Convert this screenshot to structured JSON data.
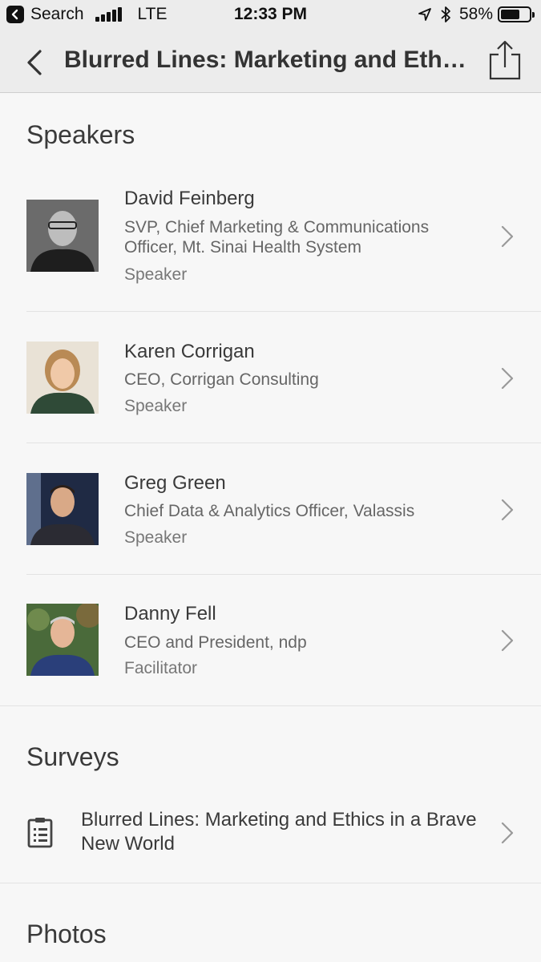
{
  "status_bar": {
    "back_app": "Search",
    "carrier": "LTE",
    "time": "12:33 PM",
    "battery": "58%",
    "battery_level": 0.58
  },
  "nav": {
    "title": "Blurred Lines: Marketing and Ethi...",
    "back_icon": "chevron-left-icon",
    "share_icon": "share-icon"
  },
  "speakers": {
    "header": "Speakers",
    "items": [
      {
        "name": "David Feinberg",
        "title": "SVP, Chief Marketing & Communications Officer, Mt. Sinai Health System",
        "role": "Speaker",
        "avatar_bg": "#5a5a5a",
        "avatar_fg": "#1e1e1e"
      },
      {
        "name": "Karen Corrigan",
        "title": "CEO, Corrigan Consulting",
        "role": "Speaker",
        "avatar_bg": "#e9e2d6",
        "avatar_fg": "#2f4a37"
      },
      {
        "name": "Greg Green",
        "title": "Chief Data & Analytics Officer, Valassis",
        "role": "Speaker",
        "avatar_bg": "#1f2a44",
        "avatar_fg": "#2b2b33"
      },
      {
        "name": "Danny Fell",
        "title": "CEO and President, ndp",
        "role": "Facilitator",
        "avatar_bg": "#4a6a3a",
        "avatar_fg": "#2a3f7a"
      }
    ]
  },
  "surveys": {
    "header": "Surveys",
    "items": [
      {
        "title": "Blurred Lines: Marketing and Ethics in a Brave New World",
        "icon": "clipboard-icon"
      }
    ]
  },
  "photos": {
    "header": "Photos"
  }
}
